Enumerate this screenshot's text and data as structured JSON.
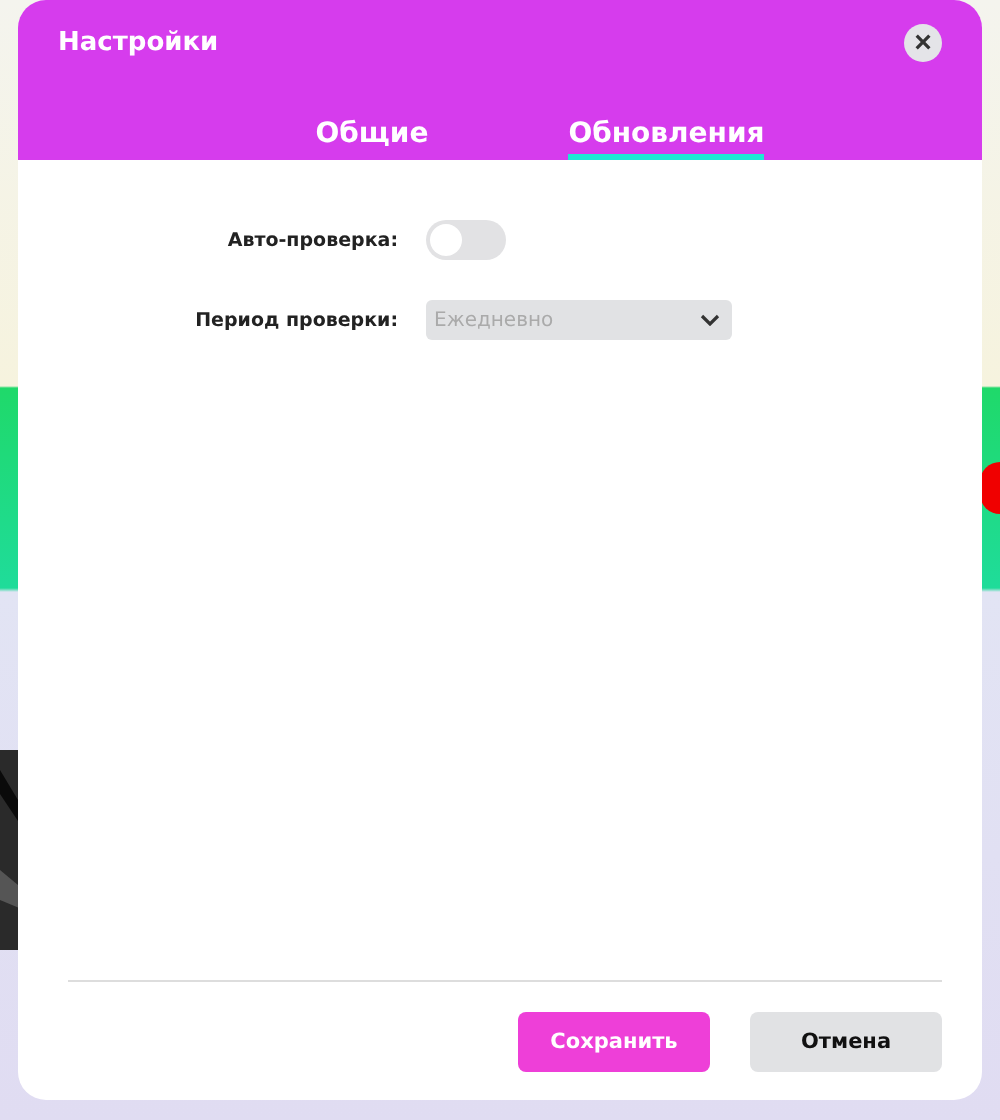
{
  "window": {
    "title": "Настройки",
    "close": "×"
  },
  "tabs": [
    {
      "label": "Общие",
      "selected": false
    },
    {
      "label": "Обновления",
      "selected": true
    }
  ],
  "settings": [
    {
      "kind": "toggle",
      "label": "Авто-проверка:",
      "on": false
    },
    {
      "kind": "select",
      "label": "Период проверки:",
      "value": "Ежедневно",
      "disabled": true
    }
  ],
  "buttons": [
    {
      "kind": "primary",
      "label": "Сохранить"
    },
    {
      "kind": "secondary",
      "label": "Отмена"
    }
  ]
}
